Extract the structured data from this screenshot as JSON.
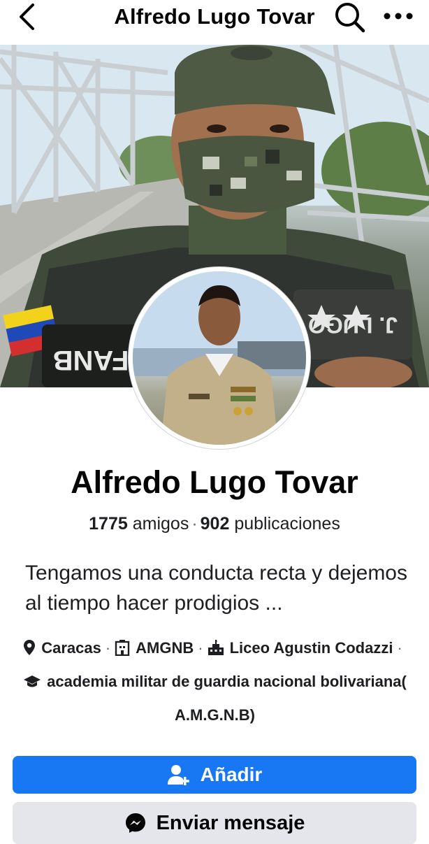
{
  "header": {
    "title": "Alfredo Lugo Tovar",
    "back_icon": "chevron-left-icon",
    "search_icon": "search-icon",
    "more_icon": "more-horizontal-icon"
  },
  "cover": {
    "patch_left_text": "FANB",
    "patch_right_text": "J. LUGO"
  },
  "profile": {
    "name": "Alfredo Lugo Tovar",
    "friends_count": "1775",
    "friends_label": "amigos",
    "separator": "·",
    "posts_count": "902",
    "posts_label": "publicaciones",
    "bio": "Tengamos una conducta recta y dejemos al tiempo hacer prodigios ..."
  },
  "details": {
    "location": "Caracas",
    "work": "AMGNB",
    "school": "Liceo Agustin Codazzi",
    "college": "academia militar de guardia nacional bolivariana( A.M.G.N.B)"
  },
  "actions": {
    "add_label": "Añadir",
    "message_label": "Enviar mensaje"
  },
  "colors": {
    "primary": "#1877f2",
    "secondary_button": "#e4e6eb"
  }
}
